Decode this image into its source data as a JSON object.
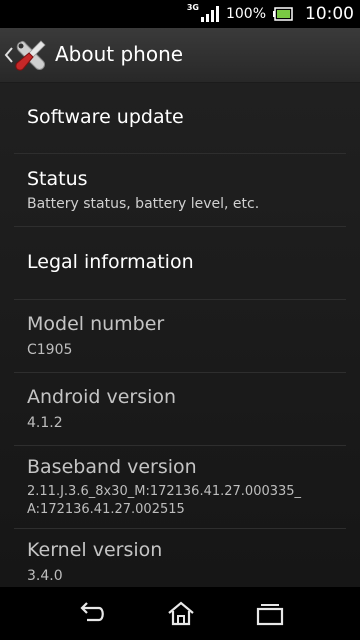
{
  "status_bar": {
    "network_type": "3G",
    "battery_percent": "100%",
    "time": "10:00",
    "battery_level": 1.0,
    "signal_level": 4
  },
  "action_bar": {
    "title": "About phone",
    "back_icon": "chevron-left-icon",
    "app_icon": "settings-tools-icon"
  },
  "items": [
    {
      "title": "Software update",
      "summary": "",
      "enabled": true
    },
    {
      "title": "Status",
      "summary": "Battery status, battery level, etc.",
      "enabled": true
    },
    {
      "title": "Legal information",
      "summary": "",
      "enabled": true
    },
    {
      "title": "Model number",
      "summary": "C1905",
      "enabled": false
    },
    {
      "title": "Android version",
      "summary": "4.1.2",
      "enabled": false
    },
    {
      "title": "Baseband version",
      "summary": "2.11.J.3.6_8x30_M:172136.41.27.000335_",
      "summary2": "A:172136.41.27.002515",
      "enabled": false
    },
    {
      "title": "Kernel version",
      "summary": "3.4.0",
      "enabled": false
    }
  ],
  "nav_bar": {
    "back": "back-icon",
    "home": "home-icon",
    "recents": "recents-icon"
  },
  "colors": {
    "background": "#1a1a1a",
    "action_bar": "#2f2f2f",
    "battery_green": "#7ac943",
    "divider": "#2e2e2e",
    "accent_red": "#c62828"
  }
}
